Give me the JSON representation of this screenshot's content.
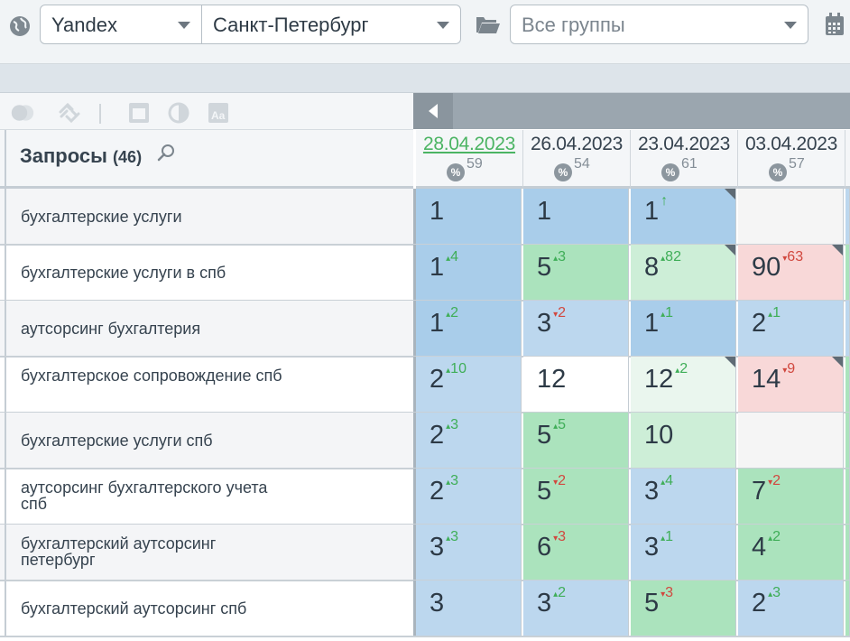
{
  "filters": {
    "engine": "Yandex",
    "city": "Санкт-Петербург",
    "groups": "Все группы"
  },
  "icons": [
    "globe-icon",
    "folder-open-icon",
    "calendar-icon",
    "toggle-icon",
    "link-icon",
    "window-icon",
    "contrast-icon",
    "font-icon",
    "search-icon",
    "collapse-left-icon"
  ],
  "queries_header": {
    "title": "Запросы",
    "count": "(46)"
  },
  "dates": [
    {
      "date": "28.04.2023",
      "percent_icon": "%",
      "percent": "59",
      "active": true
    },
    {
      "date": "26.04.2023",
      "percent_icon": "%",
      "percent": "54",
      "active": false
    },
    {
      "date": "23.04.2023",
      "percent_icon": "%",
      "percent": "61",
      "active": false
    },
    {
      "date": "03.04.2023",
      "percent_icon": "%",
      "percent": "57",
      "active": false
    }
  ],
  "rows": [
    {
      "query": "бухгалтерские услуги",
      "cells": [
        {
          "pos": "1",
          "change": "",
          "dir": "",
          "color": "blue2"
        },
        {
          "pos": "1",
          "change": "",
          "dir": "",
          "color": "blue2"
        },
        {
          "pos": "1",
          "change": "↑",
          "dir": "up",
          "color": "blue2",
          "mark": true
        },
        {
          "pos": "",
          "change": "",
          "dir": "",
          "color": "empty"
        }
      ]
    },
    {
      "query": "бухгалтерские услуги в спб",
      "cells": [
        {
          "pos": "1",
          "change": "4",
          "dir": "up",
          "color": "blue2"
        },
        {
          "pos": "5",
          "change": "3",
          "dir": "up",
          "color": "green"
        },
        {
          "pos": "8",
          "change": "82",
          "dir": "up",
          "color": "green2",
          "mark": true
        },
        {
          "pos": "90",
          "change": "63",
          "dir": "down",
          "color": "red",
          "mark": true
        }
      ]
    },
    {
      "query": "аутсорсинг бухгалтерия",
      "cells": [
        {
          "pos": "1",
          "change": "2",
          "dir": "up",
          "color": "blue2"
        },
        {
          "pos": "3",
          "change": "2",
          "dir": "down",
          "color": "blue"
        },
        {
          "pos": "1",
          "change": "1",
          "dir": "up",
          "color": "blue2"
        },
        {
          "pos": "2",
          "change": "1",
          "dir": "up",
          "color": "blue"
        }
      ]
    },
    {
      "query": "бухгалтерское сопровождение спб",
      "cells": [
        {
          "pos": "2",
          "change": "10",
          "dir": "up",
          "color": "blue"
        },
        {
          "pos": "12",
          "change": "",
          "dir": "",
          "color": "white"
        },
        {
          "pos": "12",
          "change": "2",
          "dir": "up",
          "color": "green3",
          "mark": true
        },
        {
          "pos": "14",
          "change": "9",
          "dir": "down",
          "color": "red",
          "mark": true
        }
      ]
    },
    {
      "query": "бухгалтерские услуги спб",
      "cells": [
        {
          "pos": "2",
          "change": "3",
          "dir": "up",
          "color": "blue"
        },
        {
          "pos": "5",
          "change": "5",
          "dir": "up",
          "color": "green"
        },
        {
          "pos": "10",
          "change": "",
          "dir": "",
          "color": "green2"
        },
        {
          "pos": "",
          "change": "",
          "dir": "",
          "color": "empty"
        }
      ]
    },
    {
      "query": "аутсорсинг бухгалтерского учета спб",
      "cells": [
        {
          "pos": "2",
          "change": "3",
          "dir": "up",
          "color": "blue"
        },
        {
          "pos": "5",
          "change": "2",
          "dir": "down",
          "color": "green"
        },
        {
          "pos": "3",
          "change": "4",
          "dir": "up",
          "color": "blue"
        },
        {
          "pos": "7",
          "change": "2",
          "dir": "down",
          "color": "green"
        }
      ]
    },
    {
      "query": "бухгалтерский аутсорсинг петербург",
      "cells": [
        {
          "pos": "3",
          "change": "3",
          "dir": "up",
          "color": "blue"
        },
        {
          "pos": "6",
          "change": "3",
          "dir": "down",
          "color": "green"
        },
        {
          "pos": "3",
          "change": "1",
          "dir": "up",
          "color": "blue"
        },
        {
          "pos": "4",
          "change": "2",
          "dir": "up",
          "color": "green"
        }
      ]
    },
    {
      "query": "бухгалтерский аутсорсинг спб",
      "cells": [
        {
          "pos": "3",
          "change": "",
          "dir": "",
          "color": "blue"
        },
        {
          "pos": "3",
          "change": "2",
          "dir": "up",
          "color": "blue"
        },
        {
          "pos": "5",
          "change": "3",
          "dir": "down",
          "color": "green"
        },
        {
          "pos": "2",
          "change": "3",
          "dir": "up",
          "color": "blue"
        }
      ]
    }
  ]
}
